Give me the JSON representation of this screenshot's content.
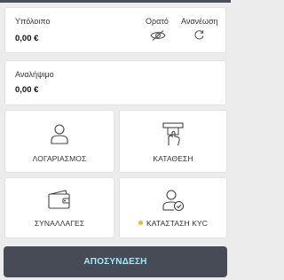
{
  "balance": {
    "label": "Υπόλοιπο",
    "amount": "0,00 €",
    "visible_label": "Ορατό",
    "refresh_label": "Ανανέωση"
  },
  "withdrawable": {
    "label": "Αναλήψιμο",
    "amount": "0,00 €"
  },
  "tiles": {
    "account": "ΛΟΓΑΡΙΑΣΜΟΣ",
    "deposit": "ΚΑΤΑΘΕΣΗ",
    "transactions": "ΣΥΝΑΛΛΑΓΕΣ",
    "kyc": "ΚΑΤΑΣΤΑΣΗ KYC"
  },
  "kyc_status_color": "#f2b632",
  "logout_label": "ΑΠΟΣΥΝΔΕΣΗ",
  "colors": {
    "background": "#ececec",
    "logout_bg": "#474b56",
    "logout_text": "#8ff0ff"
  }
}
